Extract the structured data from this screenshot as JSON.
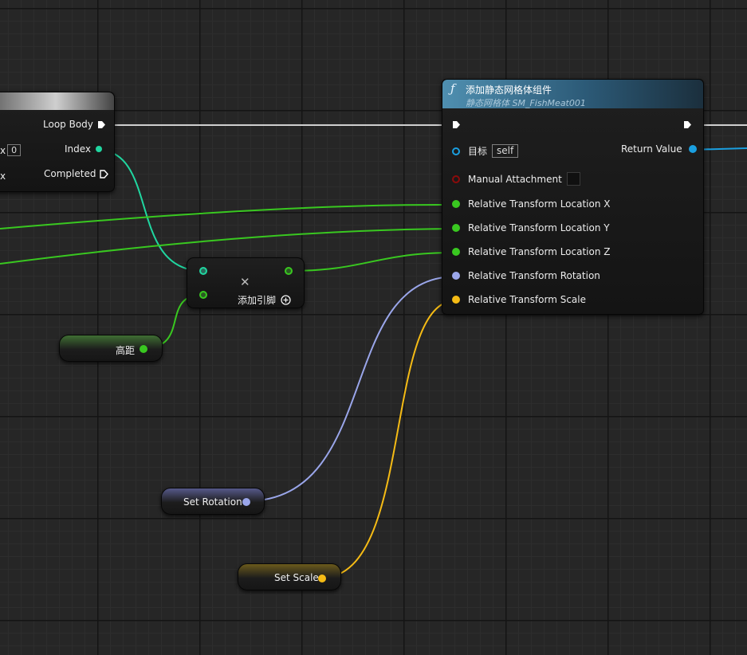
{
  "loop_node": {
    "pins": {
      "loop_body": "Loop Body",
      "index": "Index",
      "completed": "Completed"
    },
    "left_pin_x_value": "0",
    "left_pin_x_label": "x",
    "left_pin_x2_label": "x"
  },
  "add_node": {
    "x_symbol": "✕",
    "add_pin_label": "添加引脚"
  },
  "function_node": {
    "icon": "function-icon",
    "title": "添加静态网格体组件",
    "subtitle": "静态网格体 SM_FishMeat001",
    "target_label": "目标",
    "target_value": "self",
    "return_label": "Return Value",
    "manual_attachment_label": "Manual Attachment",
    "loc_x_label": "Relative Transform Location X",
    "loc_y_label": "Relative Transform Location Y",
    "loc_z_label": "Relative Transform Location Z",
    "rotation_label": "Relative Transform Rotation",
    "scale_label": "Relative Transform Scale"
  },
  "variables": {
    "height": "高距",
    "set_rotation": "Set Rotation",
    "set_scale": "Set Scale"
  },
  "colors": {
    "exec": "#e8e8e8",
    "integer": "#20d6a0",
    "float": "#39c820",
    "rotator": "#9aa6ea",
    "vector": "#f5bb15",
    "object": "#1a9fe0",
    "boolean": "#8c0b0b"
  }
}
